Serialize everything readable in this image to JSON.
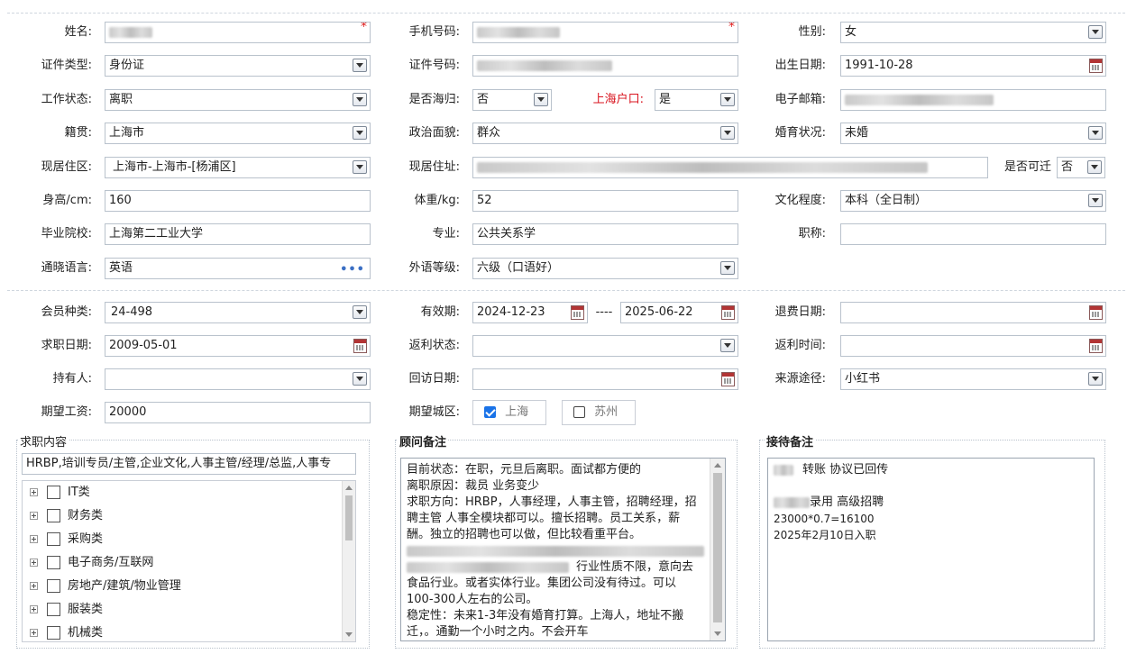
{
  "row1": {
    "name_label": "姓名:",
    "phone_label": "手机号码:",
    "gender_label": "性别:",
    "gender_value": "女"
  },
  "row2": {
    "idtype_label": "证件类型:",
    "idtype_value": "身份证",
    "idno_label": "证件号码:",
    "birth_label": "出生日期:",
    "birth_value": "1991-10-28"
  },
  "row3": {
    "work_label": "工作状态:",
    "work_value": "离职",
    "overseas_label": "是否海归:",
    "overseas_value": "否",
    "shhukou_label": "上海户口:",
    "shhukou_value": "是",
    "email_label": "电子邮箱:"
  },
  "row4": {
    "native_label": "籍贯:",
    "native_value": "上海市",
    "political_label": "政治面貌:",
    "political_value": "群众",
    "marital_label": "婚育状况:",
    "marital_value": "未婚"
  },
  "row5": {
    "residence_label": "现居住区:",
    "residence_value": "上海市-上海市-[杨浦区]",
    "address_label": "现居住址:",
    "relocate_label": "是否可迁",
    "relocate_value": "否"
  },
  "row6": {
    "height_label": "身高/cm:",
    "height_value": "160",
    "weight_label": "体重/kg:",
    "weight_value": "52",
    "edu_label": "文化程度:",
    "edu_value": "本科（全日制）"
  },
  "row7": {
    "school_label": "毕业院校:",
    "school_value": "上海第二工业大学",
    "major_label": "专业:",
    "major_value": "公共关系学",
    "title_label": "职称:",
    "title_value": ""
  },
  "row8": {
    "lang_label": "通晓语言:",
    "lang_value": "英语",
    "lang_more": "•••",
    "level_label": "外语等级:",
    "level_value": "六级（口语好）"
  },
  "row9": {
    "member_label": "会员种类:",
    "member_value": "24-498",
    "valid_label": "有效期:",
    "valid_from": "2024-12-23",
    "valid_sep": "----",
    "valid_to": "2025-06-22",
    "refund_label": "退费日期:"
  },
  "row10": {
    "seek_label": "求职日期:",
    "seek_value": "2009-05-01",
    "rebate_label": "返利状态:",
    "rebate_time_label": "返利时间:"
  },
  "row11": {
    "holder_label": "持有人:",
    "revisit_label": "回访日期:",
    "source_label": "来源途径:",
    "source_value": "小红书"
  },
  "row12": {
    "salary_label": "期望工资:",
    "salary_value": "20000",
    "city_label": "期望城区:",
    "city_options": [
      {
        "label": "上海",
        "checked": true
      },
      {
        "label": "苏州",
        "checked": false
      }
    ]
  },
  "job_content": {
    "title": "求职内容",
    "summary": "HRBP,培训专员/主管,企业文化,人事主管/经理/总监,人事专",
    "tree": [
      "IT类",
      "财务类",
      "采购类",
      "电子商务/互联网",
      "房地产/建筑/物业管理",
      "服装类",
      "机械类"
    ]
  },
  "advisor_note": {
    "title": "顾问备注",
    "lines": [
      "目前状态：在职，元旦后离职。面试都方便的",
      "离职原因：裁员 业务变少",
      "求职方向：HRBP，人事经理，人事主管，招聘经理，招",
      "聘主管 人事全模块都可以。擅长招聘。员工关系，薪",
      "酬。独立的招聘也可以做，但比较看重平台。",
      "",
      "行业性质不限，意向去",
      "食品行业。或者实体行业。集团公司没有待过。可以",
      "100-300人左右的公司。",
      "稳定性：未来1-3年没有婚育打算。上海人，地址不搬",
      "迁，。通勤一个小时之内。不会开车"
    ]
  },
  "reception_note": {
    "title": "接待备注",
    "lines": [
      "转账 协议已回传",
      "",
      "录用 高级招聘",
      "23000*0.7=16100",
      "2025年2月10日入职"
    ]
  }
}
